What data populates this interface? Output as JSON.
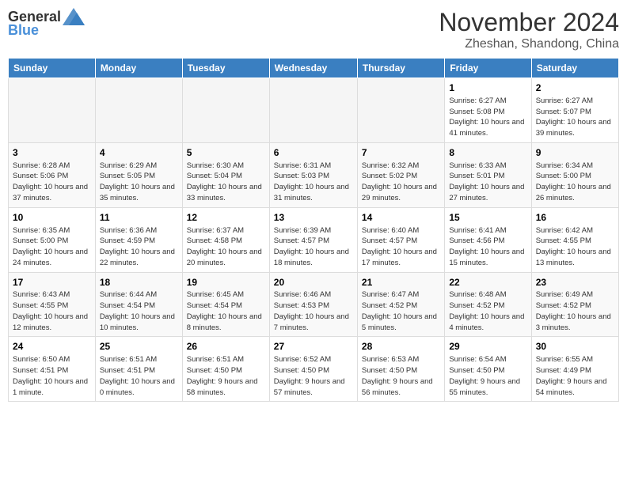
{
  "header": {
    "logo": {
      "general": "General",
      "blue": "Blue"
    },
    "title": "November 2024",
    "location": "Zheshan, Shandong, China"
  },
  "calendar": {
    "headers": [
      "Sunday",
      "Monday",
      "Tuesday",
      "Wednesday",
      "Thursday",
      "Friday",
      "Saturday"
    ],
    "weeks": [
      [
        {
          "day": "",
          "empty": true
        },
        {
          "day": "",
          "empty": true
        },
        {
          "day": "",
          "empty": true
        },
        {
          "day": "",
          "empty": true
        },
        {
          "day": "",
          "empty": true
        },
        {
          "day": "1",
          "info": "Sunrise: 6:27 AM\nSunset: 5:08 PM\nDaylight: 10 hours and 41 minutes."
        },
        {
          "day": "2",
          "info": "Sunrise: 6:27 AM\nSunset: 5:07 PM\nDaylight: 10 hours and 39 minutes."
        }
      ],
      [
        {
          "day": "3",
          "info": "Sunrise: 6:28 AM\nSunset: 5:06 PM\nDaylight: 10 hours and 37 minutes."
        },
        {
          "day": "4",
          "info": "Sunrise: 6:29 AM\nSunset: 5:05 PM\nDaylight: 10 hours and 35 minutes."
        },
        {
          "day": "5",
          "info": "Sunrise: 6:30 AM\nSunset: 5:04 PM\nDaylight: 10 hours and 33 minutes."
        },
        {
          "day": "6",
          "info": "Sunrise: 6:31 AM\nSunset: 5:03 PM\nDaylight: 10 hours and 31 minutes."
        },
        {
          "day": "7",
          "info": "Sunrise: 6:32 AM\nSunset: 5:02 PM\nDaylight: 10 hours and 29 minutes."
        },
        {
          "day": "8",
          "info": "Sunrise: 6:33 AM\nSunset: 5:01 PM\nDaylight: 10 hours and 27 minutes."
        },
        {
          "day": "9",
          "info": "Sunrise: 6:34 AM\nSunset: 5:00 PM\nDaylight: 10 hours and 26 minutes."
        }
      ],
      [
        {
          "day": "10",
          "info": "Sunrise: 6:35 AM\nSunset: 5:00 PM\nDaylight: 10 hours and 24 minutes."
        },
        {
          "day": "11",
          "info": "Sunrise: 6:36 AM\nSunset: 4:59 PM\nDaylight: 10 hours and 22 minutes."
        },
        {
          "day": "12",
          "info": "Sunrise: 6:37 AM\nSunset: 4:58 PM\nDaylight: 10 hours and 20 minutes."
        },
        {
          "day": "13",
          "info": "Sunrise: 6:39 AM\nSunset: 4:57 PM\nDaylight: 10 hours and 18 minutes."
        },
        {
          "day": "14",
          "info": "Sunrise: 6:40 AM\nSunset: 4:57 PM\nDaylight: 10 hours and 17 minutes."
        },
        {
          "day": "15",
          "info": "Sunrise: 6:41 AM\nSunset: 4:56 PM\nDaylight: 10 hours and 15 minutes."
        },
        {
          "day": "16",
          "info": "Sunrise: 6:42 AM\nSunset: 4:55 PM\nDaylight: 10 hours and 13 minutes."
        }
      ],
      [
        {
          "day": "17",
          "info": "Sunrise: 6:43 AM\nSunset: 4:55 PM\nDaylight: 10 hours and 12 minutes."
        },
        {
          "day": "18",
          "info": "Sunrise: 6:44 AM\nSunset: 4:54 PM\nDaylight: 10 hours and 10 minutes."
        },
        {
          "day": "19",
          "info": "Sunrise: 6:45 AM\nSunset: 4:54 PM\nDaylight: 10 hours and 8 minutes."
        },
        {
          "day": "20",
          "info": "Sunrise: 6:46 AM\nSunset: 4:53 PM\nDaylight: 10 hours and 7 minutes."
        },
        {
          "day": "21",
          "info": "Sunrise: 6:47 AM\nSunset: 4:52 PM\nDaylight: 10 hours and 5 minutes."
        },
        {
          "day": "22",
          "info": "Sunrise: 6:48 AM\nSunset: 4:52 PM\nDaylight: 10 hours and 4 minutes."
        },
        {
          "day": "23",
          "info": "Sunrise: 6:49 AM\nSunset: 4:52 PM\nDaylight: 10 hours and 3 minutes."
        }
      ],
      [
        {
          "day": "24",
          "info": "Sunrise: 6:50 AM\nSunset: 4:51 PM\nDaylight: 10 hours and 1 minute."
        },
        {
          "day": "25",
          "info": "Sunrise: 6:51 AM\nSunset: 4:51 PM\nDaylight: 10 hours and 0 minutes."
        },
        {
          "day": "26",
          "info": "Sunrise: 6:51 AM\nSunset: 4:50 PM\nDaylight: 9 hours and 58 minutes."
        },
        {
          "day": "27",
          "info": "Sunrise: 6:52 AM\nSunset: 4:50 PM\nDaylight: 9 hours and 57 minutes."
        },
        {
          "day": "28",
          "info": "Sunrise: 6:53 AM\nSunset: 4:50 PM\nDaylight: 9 hours and 56 minutes."
        },
        {
          "day": "29",
          "info": "Sunrise: 6:54 AM\nSunset: 4:50 PM\nDaylight: 9 hours and 55 minutes."
        },
        {
          "day": "30",
          "info": "Sunrise: 6:55 AM\nSunset: 4:49 PM\nDaylight: 9 hours and 54 minutes."
        }
      ]
    ]
  }
}
